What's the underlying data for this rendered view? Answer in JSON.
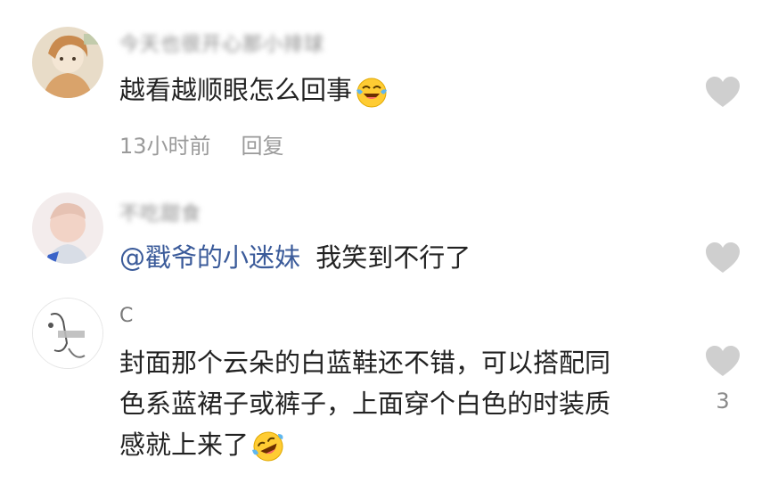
{
  "colors": {
    "background": "#ffffff",
    "text": "#222222",
    "muted": "#9a9a9a",
    "mention": "#3b5b9a",
    "like_icon": "#cfcfcf",
    "emoji_yellow": "#ffcc33",
    "emoji_tear": "#5fb7f0"
  },
  "comments": [
    {
      "username": "今天也很开心那小排球",
      "text": "越看越顺眼怎么回事",
      "emoji_icon": "crying-laughing-emoji-icon",
      "time": "13小时前",
      "reply_label": "回复",
      "like_icon": "heart-icon"
    },
    {
      "username": "不吃甜食",
      "mention": "@戳爷的小迷妹",
      "text": "我笑到不行了",
      "like_icon": "heart-icon"
    },
    {
      "username": "C",
      "lines": [
        "封面那个云朵的白蓝鞋还不错，可以搭配同",
        "色系蓝裙子或裤子，上面穿个白色的时装质",
        "感就上来了"
      ],
      "emoji_icon": "rolling-laughing-emoji-icon",
      "like_icon": "heart-icon",
      "like_count": "3"
    }
  ]
}
